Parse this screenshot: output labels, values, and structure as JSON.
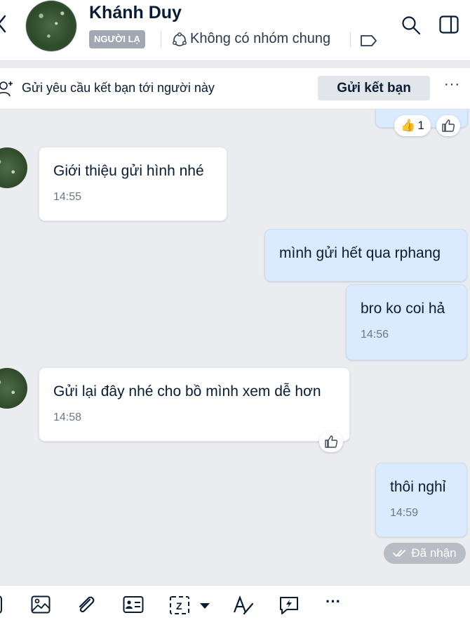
{
  "header": {
    "contact_name": "Khánh Duy",
    "badge": "NGƯỜI LẠ",
    "mutual_groups": "Không có nhóm chung"
  },
  "friend_request": {
    "text": "Gửi yêu cầu kết bạn tới người này",
    "button": "Gửi kết bạn",
    "more": "···"
  },
  "messages": [
    {
      "direction": "incoming",
      "text": "Giới thiệu gửi hình nhé",
      "time": "14:55"
    },
    {
      "direction": "outgoing",
      "text": "mình gửi hết qua rphang",
      "time": ""
    },
    {
      "direction": "outgoing",
      "text": "bro ko coi hả",
      "time": "14:56"
    },
    {
      "direction": "incoming",
      "text": "Gửi lại đây nhé cho bồ mình xem dễ hơn",
      "time": "14:58"
    },
    {
      "direction": "outgoing",
      "text": "thôi nghỉ",
      "time": "14:59"
    }
  ],
  "top_reaction": {
    "emoji": "👍",
    "count": "1"
  },
  "status": {
    "received": "Đã nhận"
  },
  "toolbar": {
    "more": "···"
  },
  "colors": {
    "outgoing_bubble": "#dbebff",
    "incoming_bubble": "#ffffff",
    "chat_bg": "#ebecf0"
  }
}
